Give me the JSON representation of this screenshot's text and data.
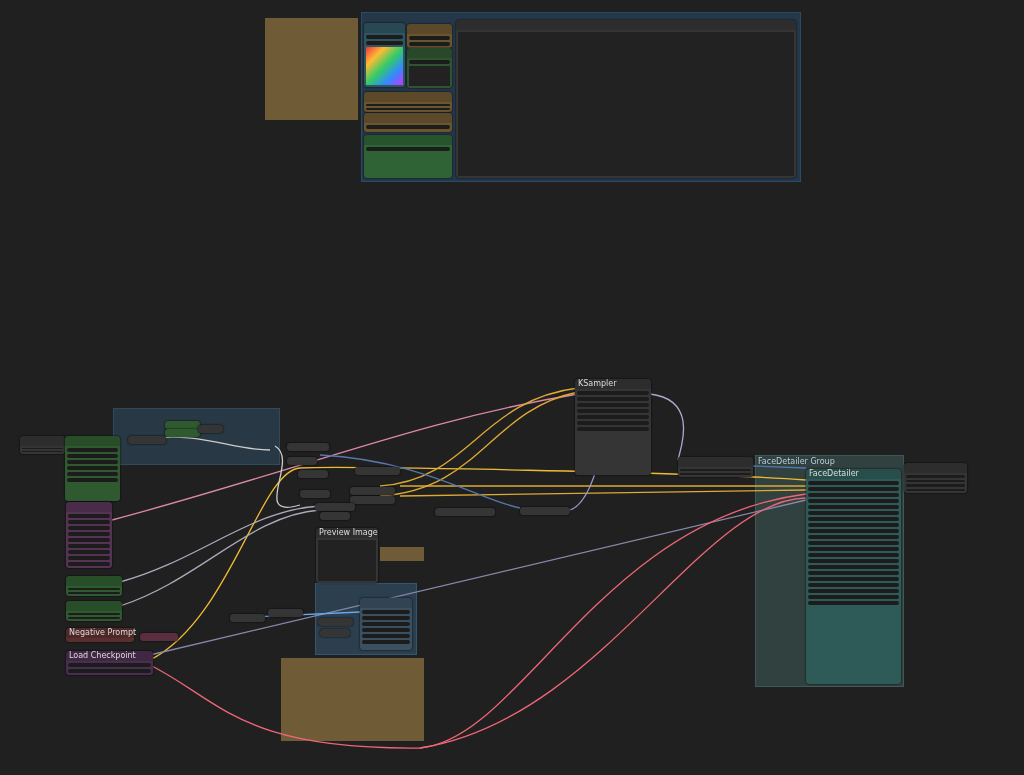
{
  "groups": [
    {
      "color": "#2a4a66"
    },
    {
      "color": "#2e4a5e"
    },
    {
      "title": "FaceDetailer Group",
      "color": "#3d5855"
    },
    {
      "color": "#34556e"
    }
  ],
  "notes": [
    {
      "color": "#6f5c37"
    },
    {
      "color": "#6f5c37"
    },
    {
      "color": "#6f5c37"
    }
  ],
  "nodes": [
    {
      "kind": "image",
      "color": "#2f5560"
    },
    {
      "kind": "node",
      "color": "#6a5530"
    },
    {
      "kind": "preview",
      "color": "#2f5530"
    },
    {
      "kind": "node",
      "color": "#6a5530"
    },
    {
      "kind": "node",
      "color": "#6a5530"
    },
    {
      "kind": "node",
      "color": "#2f6235"
    },
    {
      "kind": "preview",
      "color": "#353535"
    },
    {
      "kind": "node",
      "color": "#353535"
    },
    {
      "kind": "node",
      "color": "#2f5a30"
    },
    {
      "kind": "node",
      "color": "#553355"
    },
    {
      "kind": "node",
      "color": "#2f5a30"
    },
    {
      "kind": "node",
      "color": "#2f5a30"
    },
    {
      "title": "Negative Prompt",
      "kind": "node",
      "color": "#5a2e2e"
    },
    {
      "title": "Load Checkpoint",
      "kind": "node",
      "color": "#4a2e4f"
    },
    {
      "title": "KSampler",
      "kind": "node",
      "color": "#353535"
    },
    {
      "kind": "node",
      "color": "#353535"
    },
    {
      "title": "FaceDetailer",
      "kind": "node",
      "color": "#2e5a57"
    },
    {
      "kind": "node",
      "color": "#353535"
    },
    {
      "title": "Preview Image",
      "kind": "preview",
      "color": "#353535"
    },
    {
      "kind": "node",
      "color": "#3a4f60"
    },
    {
      "kind": "pill",
      "color": "#353535"
    },
    {
      "kind": "pill",
      "color": "#353535"
    },
    {
      "kind": "pill",
      "color": "#353535"
    },
    {
      "kind": "pill",
      "color": "#353535"
    },
    {
      "kind": "pill",
      "color": "#353535"
    },
    {
      "kind": "pill",
      "color": "#353535"
    },
    {
      "kind": "pill",
      "color": "#353535"
    },
    {
      "kind": "pill",
      "color": "#353535"
    },
    {
      "kind": "pill",
      "color": "#353535"
    },
    {
      "kind": "pill",
      "color": "#353535"
    },
    {
      "kind": "pill",
      "color": "#353535"
    },
    {
      "kind": "pill",
      "color": "#353535"
    },
    {
      "kind": "pill",
      "color": "#353535"
    },
    {
      "kind": "pill",
      "color": "#353535"
    },
    {
      "kind": "pill",
      "color": "#2f5a30"
    },
    {
      "kind": "pill",
      "color": "#2f5a30"
    },
    {
      "kind": "pill",
      "color": "#5a2e3e"
    },
    {
      "kind": "pill",
      "color": "#353535"
    },
    {
      "kind": "pill",
      "color": "#353535"
    },
    {
      "kind": "pill",
      "color": "#353535"
    }
  ]
}
